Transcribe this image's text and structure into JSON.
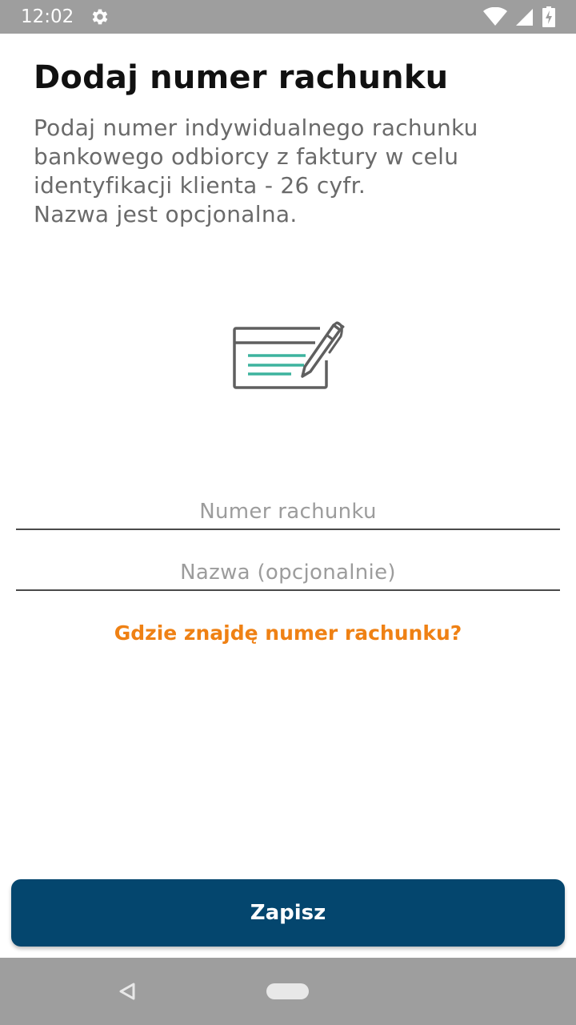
{
  "status_bar": {
    "time": "12:02",
    "icons": [
      "gear-icon",
      "wifi-icon",
      "cellular-signal-icon",
      "battery-charging-icon"
    ]
  },
  "header": {
    "title": "Dodaj numer rachunku"
  },
  "description": {
    "lines": [
      "Podaj numer indywidualnego rachunku",
      "bankowego odbiorcy z faktury w celu",
      "identyfikacji klienta - 26 cyfr.",
      "Nazwa jest opcjonalna."
    ]
  },
  "illustration": {
    "icon": "check-signing-icon",
    "colors": {
      "outline": "#5f5f5f",
      "lines": "#3db39e"
    }
  },
  "form": {
    "account_number": {
      "value": "",
      "placeholder": "Numer rachunku"
    },
    "name": {
      "value": "",
      "placeholder": "Nazwa (opcjonalnie)"
    }
  },
  "help_link": {
    "label": "Gdzie znajdę numer rachunku?",
    "color": "#ef8114"
  },
  "actions": {
    "save_label": "Zapisz",
    "color": "#04466e"
  },
  "nav_bar": {
    "icons": [
      "back-icon",
      "home-pill-icon"
    ]
  }
}
